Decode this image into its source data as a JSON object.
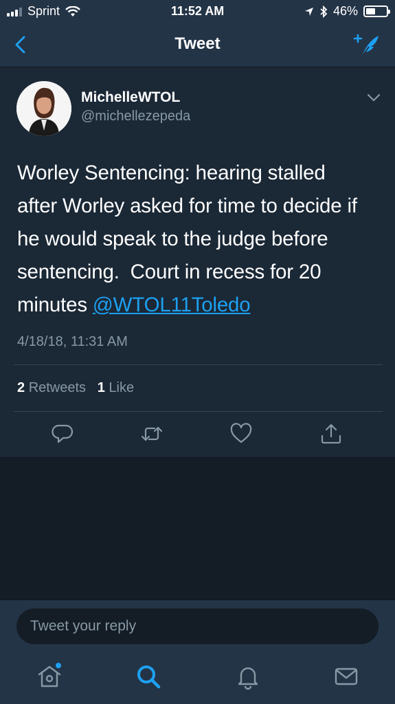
{
  "status_bar": {
    "carrier": "Sprint",
    "time": "11:52 AM",
    "battery": "46%",
    "battery_level": 0.46
  },
  "nav": {
    "title": "Tweet",
    "back_icon": "chevron-left-icon",
    "compose_icon": "compose-tweet-icon"
  },
  "tweet": {
    "author_name": "MichelleWTOL",
    "author_handle": "@michellezepeda",
    "text_lines": [
      "Worley Sentencing: hearing stalled",
      "after Worley asked for time to decide if",
      "he would speak to the judge before",
      "sentencing.  Court in recess for 20"
    ],
    "text_last_prefix": "minutes ",
    "mention": "@WTOL11Toledo",
    "timestamp": "4/18/18, 11:31 AM",
    "retweet_count": "2",
    "retweet_label": "Retweets",
    "like_count": "1",
    "like_label": "Like"
  },
  "reply": {
    "placeholder": "Tweet your reply"
  },
  "colors": {
    "accent": "#1da1f2",
    "background": "#141d26",
    "card": "#1b2836",
    "bar": "#243447",
    "secondary_text": "#8899a6"
  }
}
